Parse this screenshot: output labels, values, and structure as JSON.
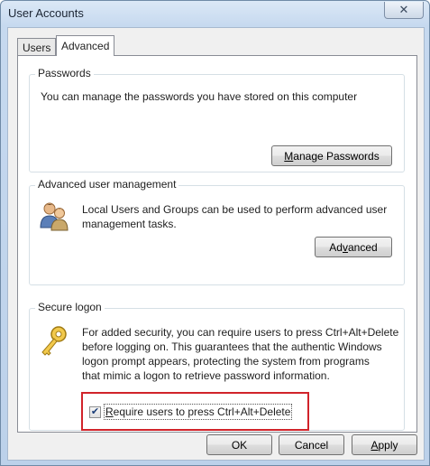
{
  "window": {
    "title": "User Accounts",
    "close_symbol": "✕"
  },
  "tabs": [
    {
      "label": "Users"
    },
    {
      "label": "Advanced"
    }
  ],
  "passwords": {
    "title": "Passwords",
    "description": "You can manage the passwords you have stored on this computer",
    "button_pre": "",
    "button_mnemonic": "M",
    "button_post": "anage Passwords"
  },
  "advanced": {
    "title": "Advanced user management",
    "description_line1": "Local Users and Groups can be used to perform advanced user",
    "description_line2": "management tasks.",
    "button_pre": "Ad",
    "button_mnemonic": "v",
    "button_post": "anced"
  },
  "secure_logon": {
    "title": "Secure logon",
    "lines": [
      "For added security, you can require users to press Ctrl+Alt+Delete",
      "before logging on. This guarantees that the authentic Windows",
      "logon prompt appears, protecting the system from programs",
      "that mimic a logon to retrieve password information."
    ],
    "checkbox_pre": "",
    "checkbox_mnemonic": "R",
    "checkbox_post": "equire users to press Ctrl+Alt+Delete",
    "checkbox_checked": true,
    "check_symbol": "✔"
  },
  "footer": {
    "ok": "OK",
    "cancel": "Cancel",
    "apply_mnemonic": "A",
    "apply_post": "pply"
  },
  "colors": {
    "highlight": "#d1232a"
  }
}
